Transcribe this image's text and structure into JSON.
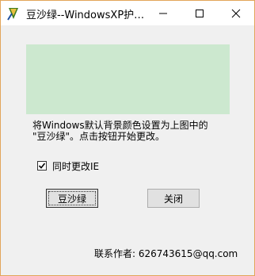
{
  "window": {
    "title": "豆沙绿--WindowsXP护…"
  },
  "main": {
    "description_line1": "将Windows默认背景颜色设置为上图中的",
    "description_line2": "\"豆沙绿\"。点击按钮开始更改。",
    "checkbox_label": "同时更改IE",
    "checkbox_checked": true,
    "apply_button": "豆沙绿",
    "close_button": "关闭",
    "contact": "联系作者: 626743615@qq.com"
  },
  "colors": {
    "preview": "#cce8cf",
    "window_border": "#e2a55a"
  }
}
